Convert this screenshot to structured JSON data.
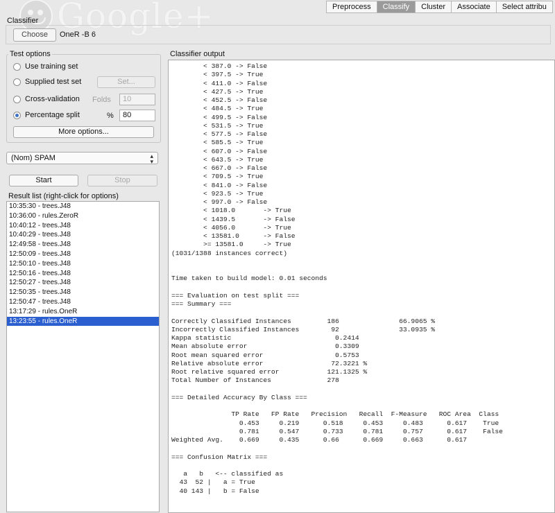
{
  "watermark": {
    "text": "Google+"
  },
  "tabs": [
    {
      "label": "Preprocess",
      "active": false
    },
    {
      "label": "Classify",
      "active": true
    },
    {
      "label": "Cluster",
      "active": false
    },
    {
      "label": "Associate",
      "active": false
    },
    {
      "label": "Select attribu",
      "active": false
    }
  ],
  "classifier": {
    "label": "Classifier",
    "choose_label": "Choose",
    "value": "OneR -B 6"
  },
  "test_options": {
    "title": "Test options",
    "use_training_label": "Use training set",
    "supplied_test_label": "Supplied test set",
    "set_label": "Set...",
    "cross_validation_label": "Cross-validation",
    "folds_label": "Folds",
    "folds_value": "10",
    "percentage_split_label": "Percentage split",
    "percent_symbol": "%",
    "percentage_value": "80",
    "selected": "percentage_split",
    "more_options_label": "More options..."
  },
  "class_select": {
    "value": "(Nom) SPAM"
  },
  "actions": {
    "start_label": "Start",
    "stop_label": "Stop"
  },
  "result_list": {
    "title": "Result list (right-click for options)",
    "items": [
      {
        "label": "10:35:30 - trees.J48",
        "selected": false
      },
      {
        "label": "10:36:00 - rules.ZeroR",
        "selected": false
      },
      {
        "label": "10:40:12 - trees.J48",
        "selected": false
      },
      {
        "label": "10:40:29 - trees.J48",
        "selected": false
      },
      {
        "label": "12:49:58 - trees.J48",
        "selected": false
      },
      {
        "label": "12:50:09 - trees.J48",
        "selected": false
      },
      {
        "label": "12:50:10 - trees.J48",
        "selected": false
      },
      {
        "label": "12:50:16 - trees.J48",
        "selected": false
      },
      {
        "label": "12:50:27 - trees.J48",
        "selected": false
      },
      {
        "label": "12:50:35 - trees.J48",
        "selected": false
      },
      {
        "label": "12:50:47 - trees.J48",
        "selected": false
      },
      {
        "label": "13:17:29 - rules.OneR",
        "selected": false
      },
      {
        "label": "13:23:55 - rules.OneR",
        "selected": true
      }
    ]
  },
  "output": {
    "title": "Classifier output",
    "lines": [
      "        < 387.0 -> False",
      "        < 397.5 -> True",
      "        < 411.0 -> False",
      "        < 427.5 -> True",
      "        < 452.5 -> False",
      "        < 484.5 -> True",
      "        < 499.5 -> False",
      "        < 531.5 -> True",
      "        < 577.5 -> False",
      "        < 585.5 -> True",
      "        < 607.0 -> False",
      "        < 643.5 -> True",
      "        < 667.0 -> False",
      "        < 709.5 -> True",
      "        < 841.0 -> False",
      "        < 923.5 -> True",
      "        < 997.0 -> False",
      "        < 1018.0       -> True",
      "        < 1439.5       -> False",
      "        < 4056.0       -> True",
      "        < 13581.0      -> False",
      "        >= 13581.0     -> True",
      "(1031/1388 instances correct)",
      "",
      "",
      "Time taken to build model: 0.01 seconds",
      "",
      "=== Evaluation on test split ===",
      "=== Summary ===",
      "",
      "Correctly Classified Instances         186               66.9065 %",
      "Incorrectly Classified Instances        92               33.0935 %",
      "Kappa statistic                          0.2414",
      "Mean absolute error                      0.3309",
      "Root mean squared error                  0.5753",
      "Relative absolute error                 72.3221 %",
      "Root relative squared error            121.1325 %",
      "Total Number of Instances              278",
      "",
      "=== Detailed Accuracy By Class ===",
      "",
      "               TP Rate   FP Rate   Precision   Recall  F-Measure   ROC Area  Class",
      "                 0.453     0.219      0.518     0.453     0.483      0.617    True",
      "                 0.781     0.547      0.733     0.781     0.757      0.617    False",
      "Weighted Avg.    0.669     0.435      0.66      0.669     0.663      0.617",
      "",
      "=== Confusion Matrix ===",
      "",
      "   a   b   <-- classified as",
      "  43  52 |   a = True",
      "  40 143 |   b = False"
    ]
  }
}
